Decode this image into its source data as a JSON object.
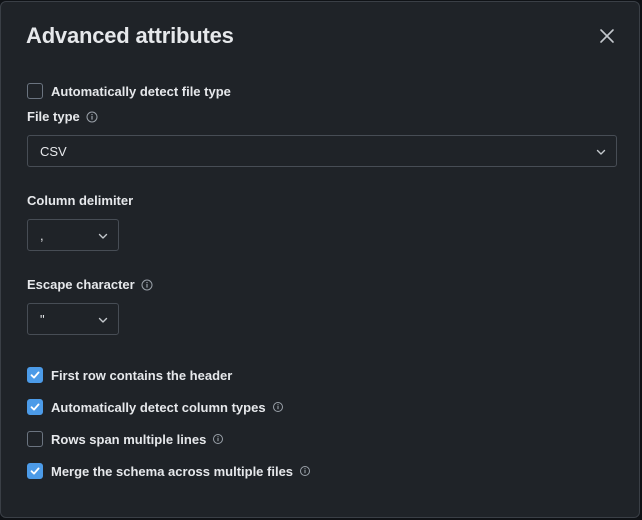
{
  "modal": {
    "title": "Advanced attributes",
    "close_label": "Close"
  },
  "auto_detect_file_type": {
    "label": "Automatically detect file type",
    "checked": false
  },
  "file_type": {
    "label": "File type",
    "value": "CSV"
  },
  "column_delimiter": {
    "label": "Column delimiter",
    "value": ","
  },
  "escape_character": {
    "label": "Escape character",
    "value": "\""
  },
  "options": [
    {
      "label": "First row contains the header",
      "checked": true,
      "info": false
    },
    {
      "label": "Automatically detect column types",
      "checked": true,
      "info": true
    },
    {
      "label": "Rows span multiple lines",
      "checked": false,
      "info": true
    },
    {
      "label": "Merge the schema across multiple files",
      "checked": true,
      "info": true
    }
  ],
  "colors": {
    "background": "#1f2328",
    "accent": "#4c9be8",
    "text": "#e6e8eb",
    "border": "#474d55"
  }
}
